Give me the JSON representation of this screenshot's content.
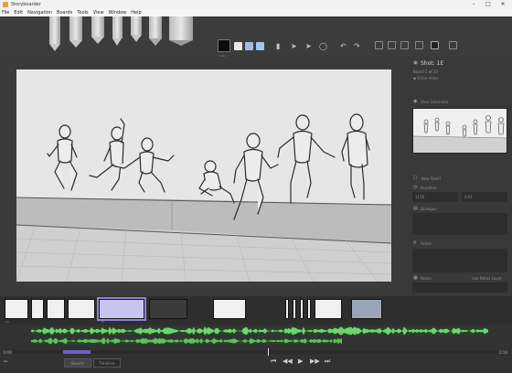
{
  "window": {
    "title": "Storyboarder"
  },
  "window_controls": {
    "minimize": "–",
    "maximize": "□",
    "close": "✕"
  },
  "menu": [
    "File",
    "Edit",
    "Navigation",
    "Boards",
    "Tools",
    "View",
    "Window",
    "Help"
  ],
  "toolbar": {
    "tools": [
      "light-pencil",
      "pencil",
      "pen",
      "brush",
      "note-pen",
      "eraser",
      "chisel-eraser"
    ],
    "swatches": [
      "#0b0b0b",
      "#e8e8e8",
      "#a9b8e4",
      "#9ec9f2"
    ],
    "swatch_label": "Size",
    "icons": [
      "pointer-icon",
      "select-icon",
      "move-icon",
      "lasso-icon",
      "undo-icon",
      "redo-icon",
      "grid-icon",
      "center-icon",
      "thirds-icon",
      "diagonal-icon",
      "onion-icon",
      "caption-icon"
    ],
    "mode_buttons": 6,
    "active_mode": 5
  },
  "panel": {
    "shot_title": "Shot: 1E",
    "board_info": "Board 5 of 22",
    "line_mileage": "◆ 6 line miles",
    "shot_generator_label": "Shot Generator",
    "new_shot_label": "New Shot?",
    "duration_label": "Duration",
    "duration_ms": "1150",
    "duration_frames": "0:01",
    "dialogue_label": "Dialogue",
    "action_label": "Action",
    "notes_label": "Notes",
    "use_layer_button": "Use Notes Layer"
  },
  "timeline": {
    "frame_count": 13,
    "selected_frame": 4,
    "time_start": "0:00",
    "time_end": "1:16",
    "board_button": "Boards",
    "timeline_button": "Timeline",
    "transport": [
      "⏮",
      "◀◀",
      "▶",
      "▶▶",
      "⏭"
    ]
  },
  "colors": {
    "accent": "#6c61c8",
    "waveform": "#6ed56e",
    "selected_frame": "#c9c4ee"
  }
}
